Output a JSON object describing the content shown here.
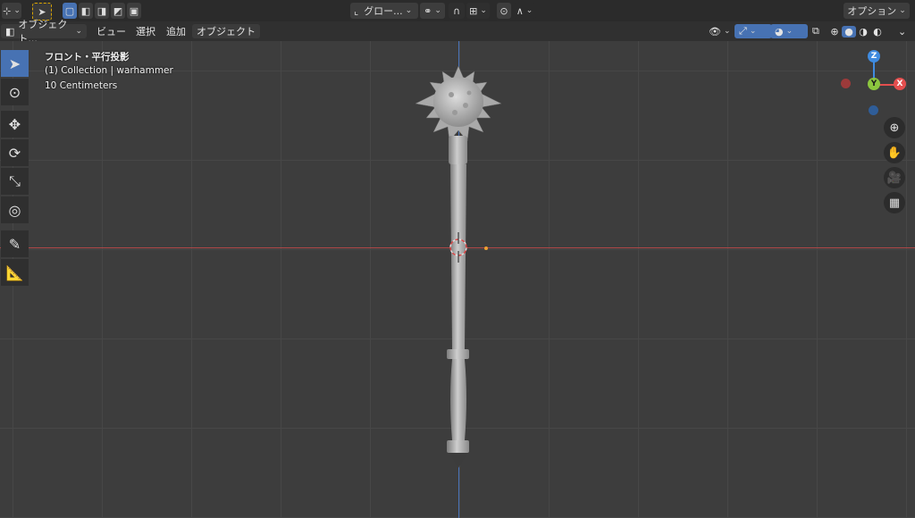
{
  "topbar": {
    "transform_orientation": "グロー...",
    "options_label": "オプション"
  },
  "header": {
    "mode_label": "オブジェクト...",
    "menus": [
      "ビュー",
      "選択",
      "追加",
      "オブジェクト"
    ]
  },
  "viewport_overlay": {
    "view_name": "フロント・平行投影",
    "collection_info": "(1) Collection | warhammer",
    "scale_info": "10 Centimeters"
  },
  "gizmo": {
    "z_label": "Z",
    "y_label": "Y",
    "x_label": "X",
    "x_color": "#e34e4e",
    "y_color": "#8cc63f",
    "z_color": "#3f8be0"
  },
  "colors": {
    "active_blue": "#4772b3",
    "x_axis": "#b04848",
    "z_axis": "#4a73b8"
  },
  "icons": {
    "tools": [
      "select-box-icon",
      "cursor-icon",
      "move-icon",
      "rotate-icon",
      "scale-icon",
      "transform-icon",
      "annotate-icon",
      "measure-icon"
    ],
    "nav": [
      "zoom-icon",
      "hand-pan-icon",
      "camera-icon",
      "grid-view-icon"
    ]
  }
}
